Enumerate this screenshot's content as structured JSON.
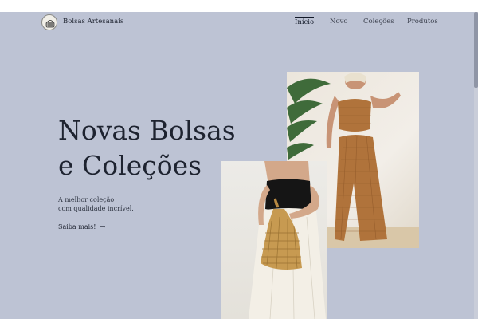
{
  "header": {
    "brand": "Bolsas Artesanais",
    "logo_icon": "woven-bag-logo-icon",
    "nav": [
      {
        "label": "Início",
        "active": true
      },
      {
        "label": "Novo",
        "active": false
      },
      {
        "label": "Coleções",
        "active": false
      },
      {
        "label": "Produtos",
        "active": false
      }
    ]
  },
  "hero": {
    "title_line1": "Novas Bolsas",
    "title_line2": "e Coleções",
    "subtitle_line1": "A melhor coleção",
    "subtitle_line2": "com qualidade incrível.",
    "cta_label": "Saiba mais!",
    "cta_icon": "arrow-right-icon"
  },
  "photos": [
    {
      "name": "photo-crochet-outfit"
    },
    {
      "name": "photo-woven-bag"
    }
  ],
  "colors": {
    "background": "#bdc3d4",
    "text": "#1e2330",
    "crochet": "#b0733b"
  }
}
